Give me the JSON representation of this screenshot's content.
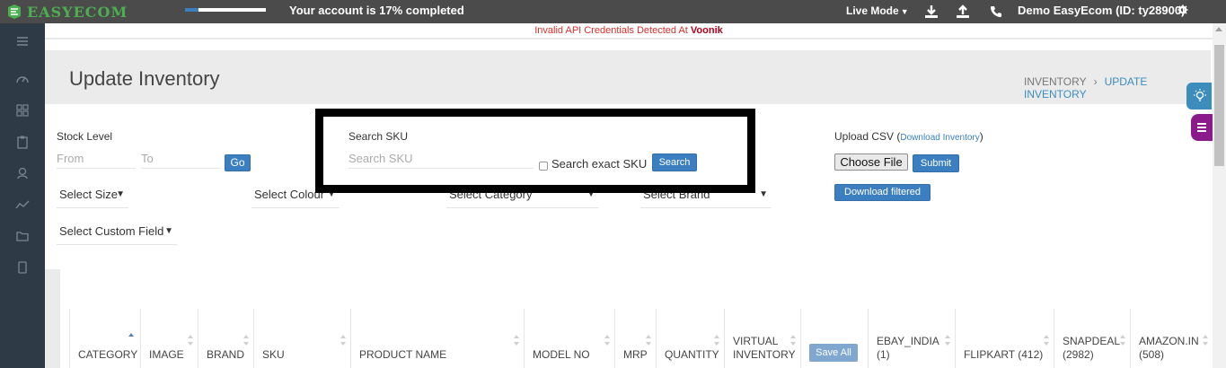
{
  "topbar": {
    "logo_text": "EASYECOM",
    "progress_percent": 17,
    "account_status": "Your account is 17% completed",
    "live_mode": "Live Mode",
    "user": "Demo EasyEcom (ID: ty28900)"
  },
  "alert": {
    "text": "Invalid API Credentials Detected At",
    "channel": "Voonik"
  },
  "header": {
    "title": "Update Inventory",
    "breadcrumb": [
      "INVENTORY",
      "UPDATE INVENTORY"
    ]
  },
  "filters": {
    "stock_level_label": "Stock Level",
    "from_placeholder": "From",
    "to_placeholder": "To",
    "go_label": "Go",
    "search_sku_label": "Search SKU",
    "search_sku_placeholder": "Search SKU",
    "exact_sku_label": "Search exact SKU",
    "search_label": "Search",
    "upload_csv_label": "Upload CSV (",
    "download_inventory_link": "Download Inventory",
    "upload_csv_close": ")",
    "choose_file_label": "Choose File",
    "submit_label": "Submit",
    "download_filtered_label": "Download filtered",
    "select_size": "Select Size",
    "select_colour": "Select Colour",
    "select_category": "Select Category",
    "select_brand": "Select Brand",
    "select_custom_field": "Select Custom Field"
  },
  "table": {
    "columns": [
      "CATEGORY",
      "IMAGE",
      "BRAND",
      "SKU",
      "PRODUCT NAME",
      "MODEL NO",
      "MRP",
      "QUANTITY",
      "VIRTUAL INVENTORY",
      "",
      "EBAY_INDIA (1)",
      "FLIPKART (412)",
      "SNAPDEAL (2982)",
      "AMAZON.IN (508)"
    ],
    "save_all_label": "Save All"
  },
  "colors": {
    "topbar": "#4b4b4b",
    "sidebar": "#2e3b46",
    "primary": "#3c7fc0",
    "alert": "#d9302c",
    "accent_purple": "#8b1a8b"
  }
}
